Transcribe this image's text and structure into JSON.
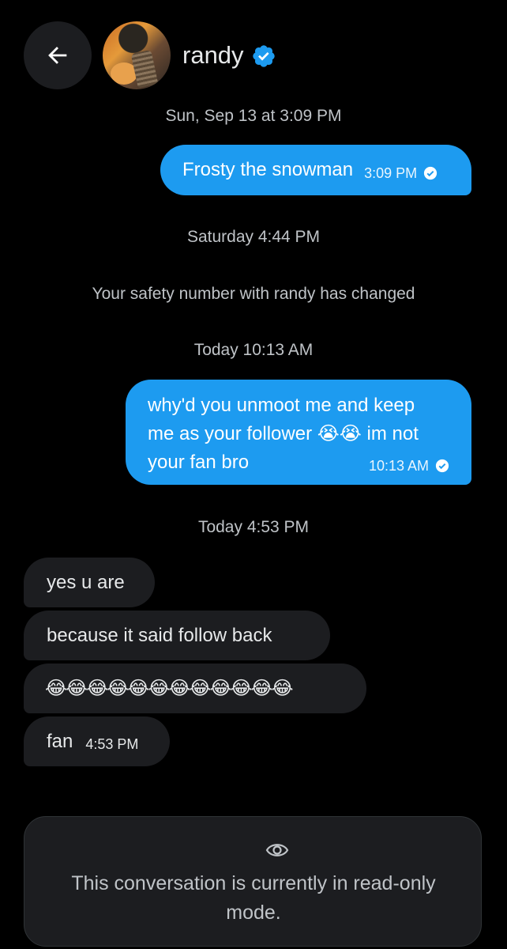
{
  "header": {
    "back_icon": "arrow-left-icon",
    "name": "randy",
    "verified_icon": "verified-badge-icon"
  },
  "colors": {
    "accent": "#1d9bf0",
    "background": "#000000",
    "incoming_bubble": "#1c1d20"
  },
  "messages": [
    {
      "type": "timestamp",
      "text": "Sun, Sep 13 at 3:09 PM"
    },
    {
      "type": "outgoing",
      "text": "Frosty the snowman",
      "time": "3:09 PM"
    },
    {
      "type": "timestamp",
      "text": "Saturday 4:44 PM"
    },
    {
      "type": "system",
      "text": "Your safety number with randy has changed"
    },
    {
      "type": "timestamp",
      "text": "Today 10:13 AM"
    },
    {
      "type": "outgoing",
      "lines": [
        "why'd you unmoot me and keep",
        "me as your follower 😭😭 im not",
        "your fan bro"
      ],
      "time": "10:13 AM"
    },
    {
      "type": "timestamp",
      "text": "Today 4:53 PM"
    },
    {
      "type": "incoming",
      "text": "yes u are"
    },
    {
      "type": "incoming",
      "text": "because it said follow back"
    },
    {
      "type": "incoming",
      "text": "😂😂😂😂😂😂😂😂😂😂😂😂"
    },
    {
      "type": "incoming",
      "text": "fan",
      "time": "4:53 PM"
    }
  ],
  "readonly": {
    "icon": "eye-icon",
    "text_line1": "This conversation is currently in read-only",
    "text_line2": "mode."
  }
}
